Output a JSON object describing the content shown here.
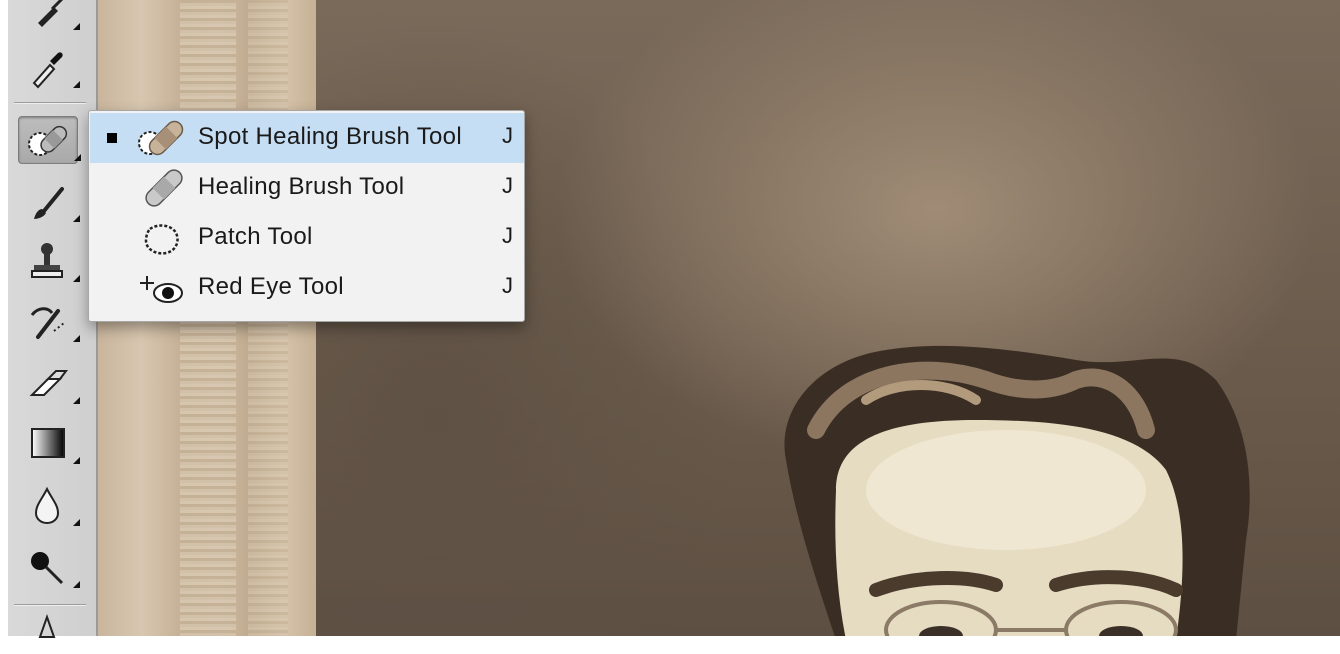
{
  "toolbar": {
    "tools": [
      {
        "icon": "pen-icon",
        "has_submenu": true
      },
      {
        "icon": "eyedropper-icon",
        "has_submenu": true
      },
      {
        "icon": "spot-healing-brush-icon",
        "has_submenu": true,
        "active": true
      },
      {
        "icon": "brush-icon",
        "has_submenu": true
      },
      {
        "icon": "clone-stamp-icon",
        "has_submenu": true
      },
      {
        "icon": "history-brush-icon",
        "has_submenu": true
      },
      {
        "icon": "eraser-icon",
        "has_submenu": true
      },
      {
        "icon": "gradient-icon",
        "has_submenu": true
      },
      {
        "icon": "blur-drop-icon",
        "has_submenu": true
      },
      {
        "icon": "dodge-icon",
        "has_submenu": true
      },
      {
        "icon": "path-selection-icon",
        "has_submenu": true
      }
    ]
  },
  "menu": {
    "items": [
      {
        "label": "Spot Healing Brush Tool",
        "shortcut": "J",
        "selected": true,
        "icon": "spot-healing-brush-icon"
      },
      {
        "label": "Healing Brush Tool",
        "shortcut": "J",
        "selected": false,
        "icon": "healing-brush-icon"
      },
      {
        "label": "Patch Tool",
        "shortcut": "J",
        "selected": false,
        "icon": "patch-icon"
      },
      {
        "label": "Red Eye Tool",
        "shortcut": "J",
        "selected": false,
        "icon": "red-eye-icon"
      }
    ]
  },
  "colors": {
    "menu_highlight": "#c6def4",
    "toolbar_bg": "#d3d3d3"
  }
}
